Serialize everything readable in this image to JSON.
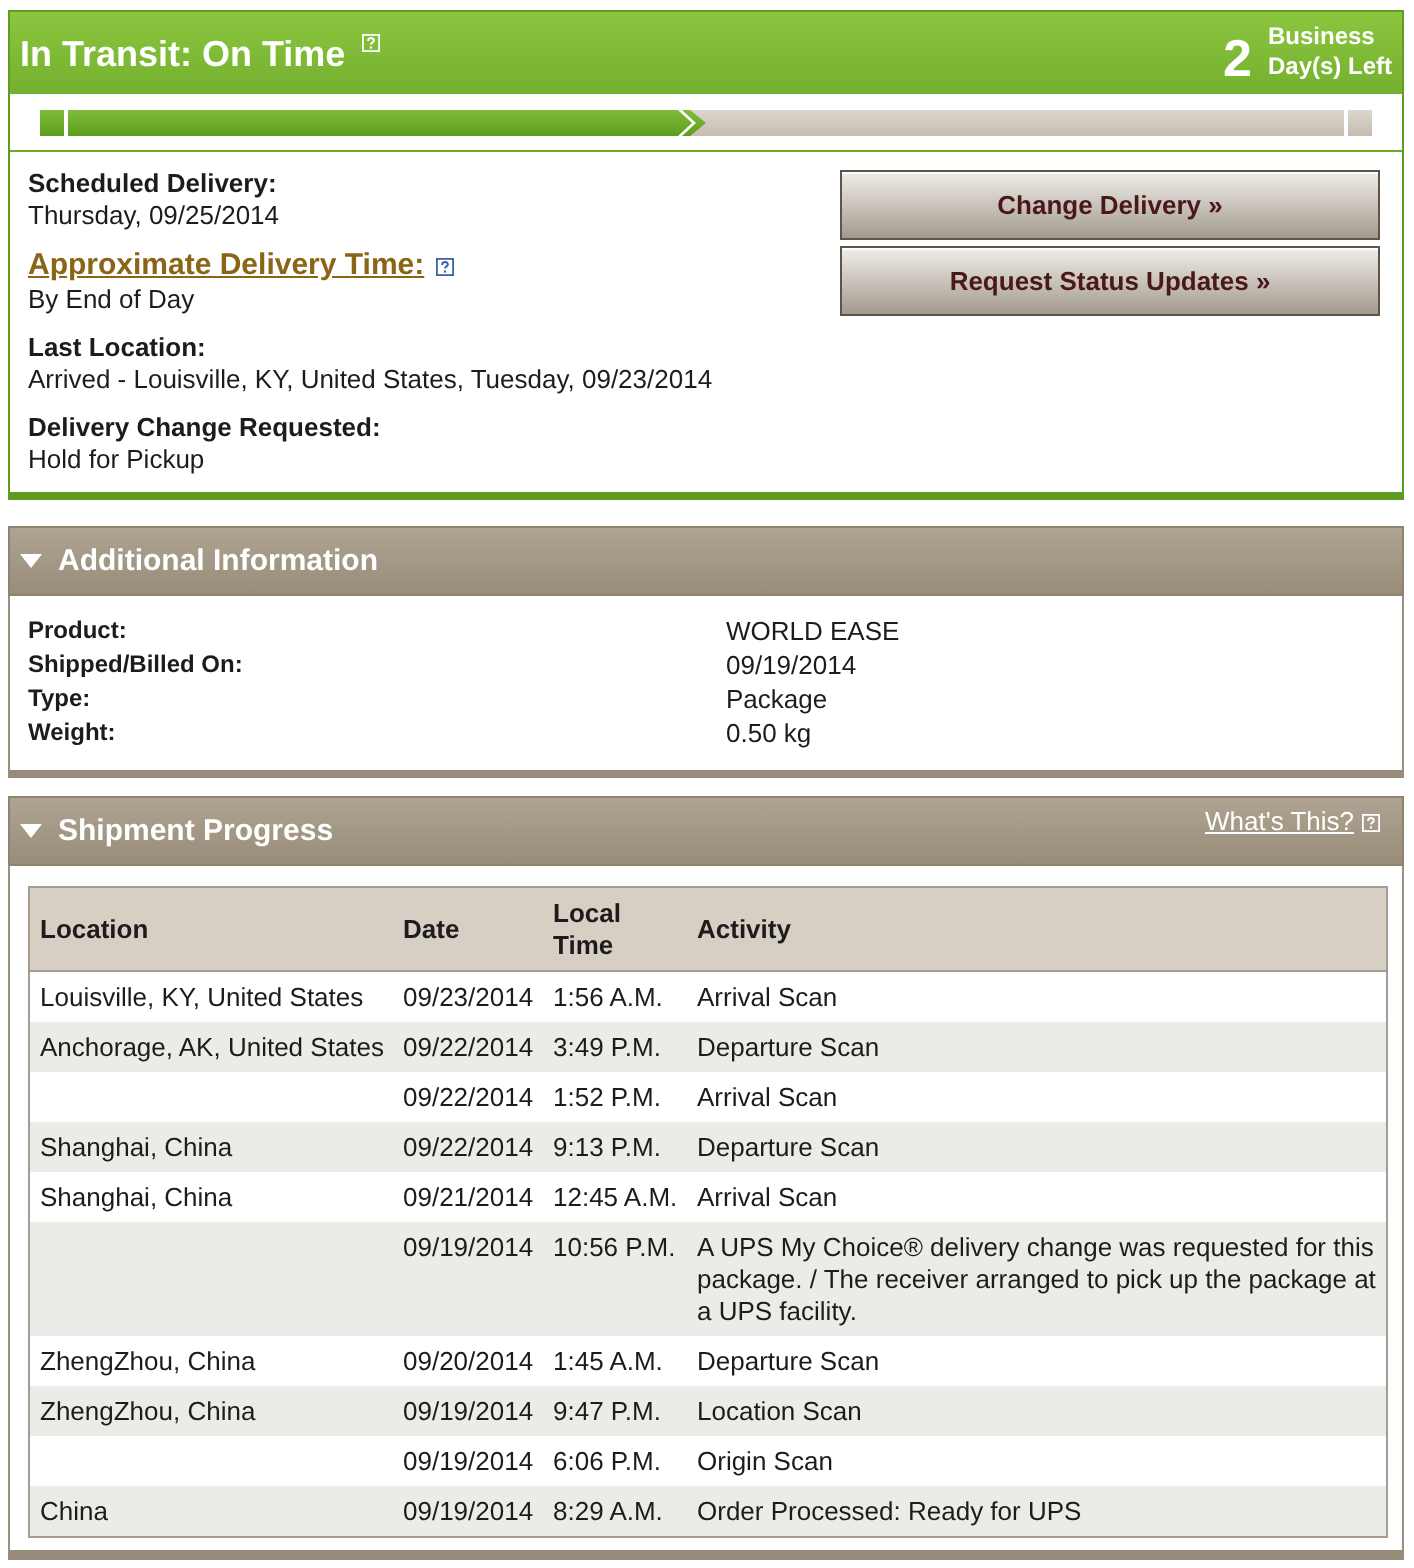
{
  "status_card": {
    "title": "In Transit: On Time",
    "days_left": {
      "count": "2",
      "label": "Business Day(s) Left"
    },
    "progress": {
      "level": 0.5
    },
    "details": [
      {
        "kind": "plain",
        "label": "Scheduled Delivery:",
        "value": "Thursday, 09/25/2014"
      },
      {
        "kind": "link",
        "label": "Approximate Delivery Time:",
        "value": "By End of Day"
      },
      {
        "kind": "plain",
        "label": "Last Location:",
        "value": "Arrived - Louisville, KY, United States, Tuesday, 09/23/2014"
      },
      {
        "kind": "plain",
        "label": "Delivery Change Requested:",
        "value": "Hold for Pickup"
      }
    ],
    "buttons": [
      "Change Delivery »",
      "Request Status Updates »"
    ]
  },
  "additional_information": {
    "title": "Additional Information",
    "expanded": true,
    "rows": [
      {
        "label": "Product:",
        "value": "WORLD EASE"
      },
      {
        "label": "Shipped/Billed On:",
        "value": "09/19/2014"
      },
      {
        "label": "Type:",
        "value": "Package"
      },
      {
        "label": "Weight:",
        "value": "0.50 kg"
      }
    ]
  },
  "shipment_progress": {
    "title": "Shipment Progress",
    "expanded": true,
    "help_link": "What's This?",
    "table": {
      "columns": [
        "Location",
        "Date",
        "Local Time",
        "Activity"
      ],
      "rows": [
        {
          "location": "Louisville, KY, United States",
          "date": "09/23/2014",
          "local_time": "1:56 A.M.",
          "activity": "Arrival Scan"
        },
        {
          "location": "Anchorage, AK, United States",
          "date": "09/22/2014",
          "local_time": "3:49 P.M.",
          "activity": "Departure Scan"
        },
        {
          "date": "09/22/2014",
          "local_time": "1:52 P.M.",
          "activity": "Arrival Scan"
        },
        {
          "location": "Shanghai, China",
          "date": "09/22/2014",
          "local_time": "9:13 P.M.",
          "activity": "Departure Scan"
        },
        {
          "location": "Shanghai, China",
          "date": "09/21/2014",
          "local_time": "12:45 A.M.",
          "activity": "Arrival Scan"
        },
        {
          "date": "09/19/2014",
          "local_time": "10:56 P.M.",
          "activity": "A UPS My Choice® delivery change was requested for this package. / The receiver arranged to pick up the package at a UPS facility."
        },
        {
          "location": "ZhengZhou, China",
          "date": "09/20/2014",
          "local_time": "1:45 A.M.",
          "activity": "Departure Scan"
        },
        {
          "location": "ZhengZhou, China",
          "date": "09/19/2014",
          "local_time": "9:47 P.M.",
          "activity": "Location Scan"
        },
        {
          "date": "09/19/2014",
          "local_time": "6:06 P.M.",
          "activity": "Origin Scan"
        },
        {
          "location": "China",
          "date": "09/19/2014",
          "local_time": "8:29 A.M.",
          "activity": "Order Processed: Ready for UPS"
        }
      ]
    }
  }
}
